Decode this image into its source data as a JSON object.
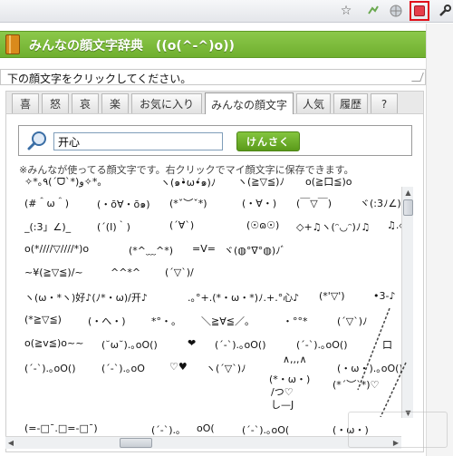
{
  "browser": {
    "icons": [
      "star-icon",
      "extension-icon",
      "globe-icon",
      "extension-highlight-icon",
      "wrench-icon"
    ]
  },
  "header": {
    "title": "みんなの顔文字辞典　((o(^-^)o))"
  },
  "hint": {
    "text": "下の顔文字をクリックしてください。"
  },
  "tabs": [
    {
      "label": "喜"
    },
    {
      "label": "怒"
    },
    {
      "label": "哀"
    },
    {
      "label": "楽"
    },
    {
      "label": "お気に入り"
    },
    {
      "label": "みんなの顔文字",
      "active": true
    },
    {
      "label": "人気"
    },
    {
      "label": "履歴"
    },
    {
      "label": "?"
    }
  ],
  "search": {
    "value": "开心",
    "button_label": "けんさく"
  },
  "note": "※みんなが使ってる顔文字です。右クリックでマイ顔文字に保存できます。",
  "emoticons": [
    [
      "✧*｡٩(ˊᗜˋ*)و✧*｡",
      "ヽ(๑•̀ω•́๑)ﾉ",
      "ヽ(≧▽≦)ﾉ",
      "o(≧口≦)o"
    ],
    [
      "(#＾ω＾)",
      "(・ō∀・ō๑)",
      "(*ˇ︶ˇ*)",
      "(・∀・)",
      "(￣▽￣)",
      "ヾ(:3ﾉ∠)ﾉ"
    ],
    [
      "_(:3」∠)_",
      "(´(I)｀)",
      "(´∀`)",
      "(☉ɷ☉)",
      "◇+♫ヽ(ᵔ◡ᵔ)ﾉ♫",
      "♫.◇"
    ],
    [
      "o(*////▽////*)o",
      "(*^﹏^*)",
      "=V=",
      "ヾ(◍°∇°◍)ﾉﾞ"
    ],
    [
      "~¥(≧▽≦)/~",
      "^^*^",
      "(´▽`)/"
    ],
    [
      "ヽ(ω・*ヽ)好♪(ﾉ*・ω)/开♪",
      ".｡°+.(*・ω・*)ﾉ.+.°心♪",
      "(*'▽')",
      "•3-♪"
    ],
    [
      "(*≧▽≦)",
      "(・へ・)",
      "*°・。",
      "＼≧∀≦／。",
      "・°°*",
      "(´▽`)ﾉ"
    ],
    [
      "o(≧v≦)o~~",
      "(˘ω˘).｡oO()",
      "❤",
      "(´-`).｡oO()",
      "(´-`).｡oO()",
      "口"
    ],
    [
      "(´-`).｡oO()",
      "(´-`).｡oO",
      "♡♥",
      "ヽ(´▽`)ﾉ",
      "∧,,,∧",
      "(・ω・).｡oO()"
    ],
    [
      "(*・ω・)",
      "/つ♡",
      "(*ˊ︶ˋ*)♡",
      "し—J"
    ],
    [
      "(=-□¯.□=-□¯)",
      "(´-`).｡",
      "oO(",
      "(´-`).｡oO(",
      "(・ω・)"
    ]
  ]
}
